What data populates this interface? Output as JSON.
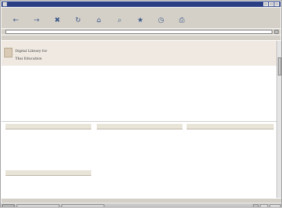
{
  "window": {
    "title": ""
  },
  "menu": [],
  "toolbar": [
    {
      "icon": "back-icon",
      "glyph": "←"
    },
    {
      "icon": "forward-icon",
      "glyph": "→"
    },
    {
      "icon": "stop-icon",
      "glyph": "✖"
    },
    {
      "icon": "refresh-icon",
      "glyph": "↻"
    },
    {
      "icon": "home-icon",
      "glyph": "⌂"
    },
    {
      "icon": "search-icon",
      "glyph": "⌕"
    },
    {
      "icon": "favorites-icon",
      "glyph": "★"
    },
    {
      "icon": "history-icon",
      "glyph": "◷"
    },
    {
      "icon": "print-icon",
      "glyph": "⎙"
    }
  ],
  "addressbar": {
    "label": "",
    "url": ""
  },
  "banner": {
    "brand_line_1": "Digital Library for",
    "brand_line_2": "Thai Education",
    "thai_tagline": ""
  },
  "page": {
    "main_title": "",
    "subtitle_1": "",
    "subtitle_2": ""
  },
  "columns": {
    "col1_header": "",
    "col2_header": "",
    "col3_header": "",
    "col4_header": ""
  },
  "colors": {
    "titlebar": "#2a3f84",
    "chrome": "#d4d0c8",
    "banner": "#efe9e2",
    "column_header": "#e8e4d8"
  },
  "taskbar": {
    "start_label": ""
  }
}
